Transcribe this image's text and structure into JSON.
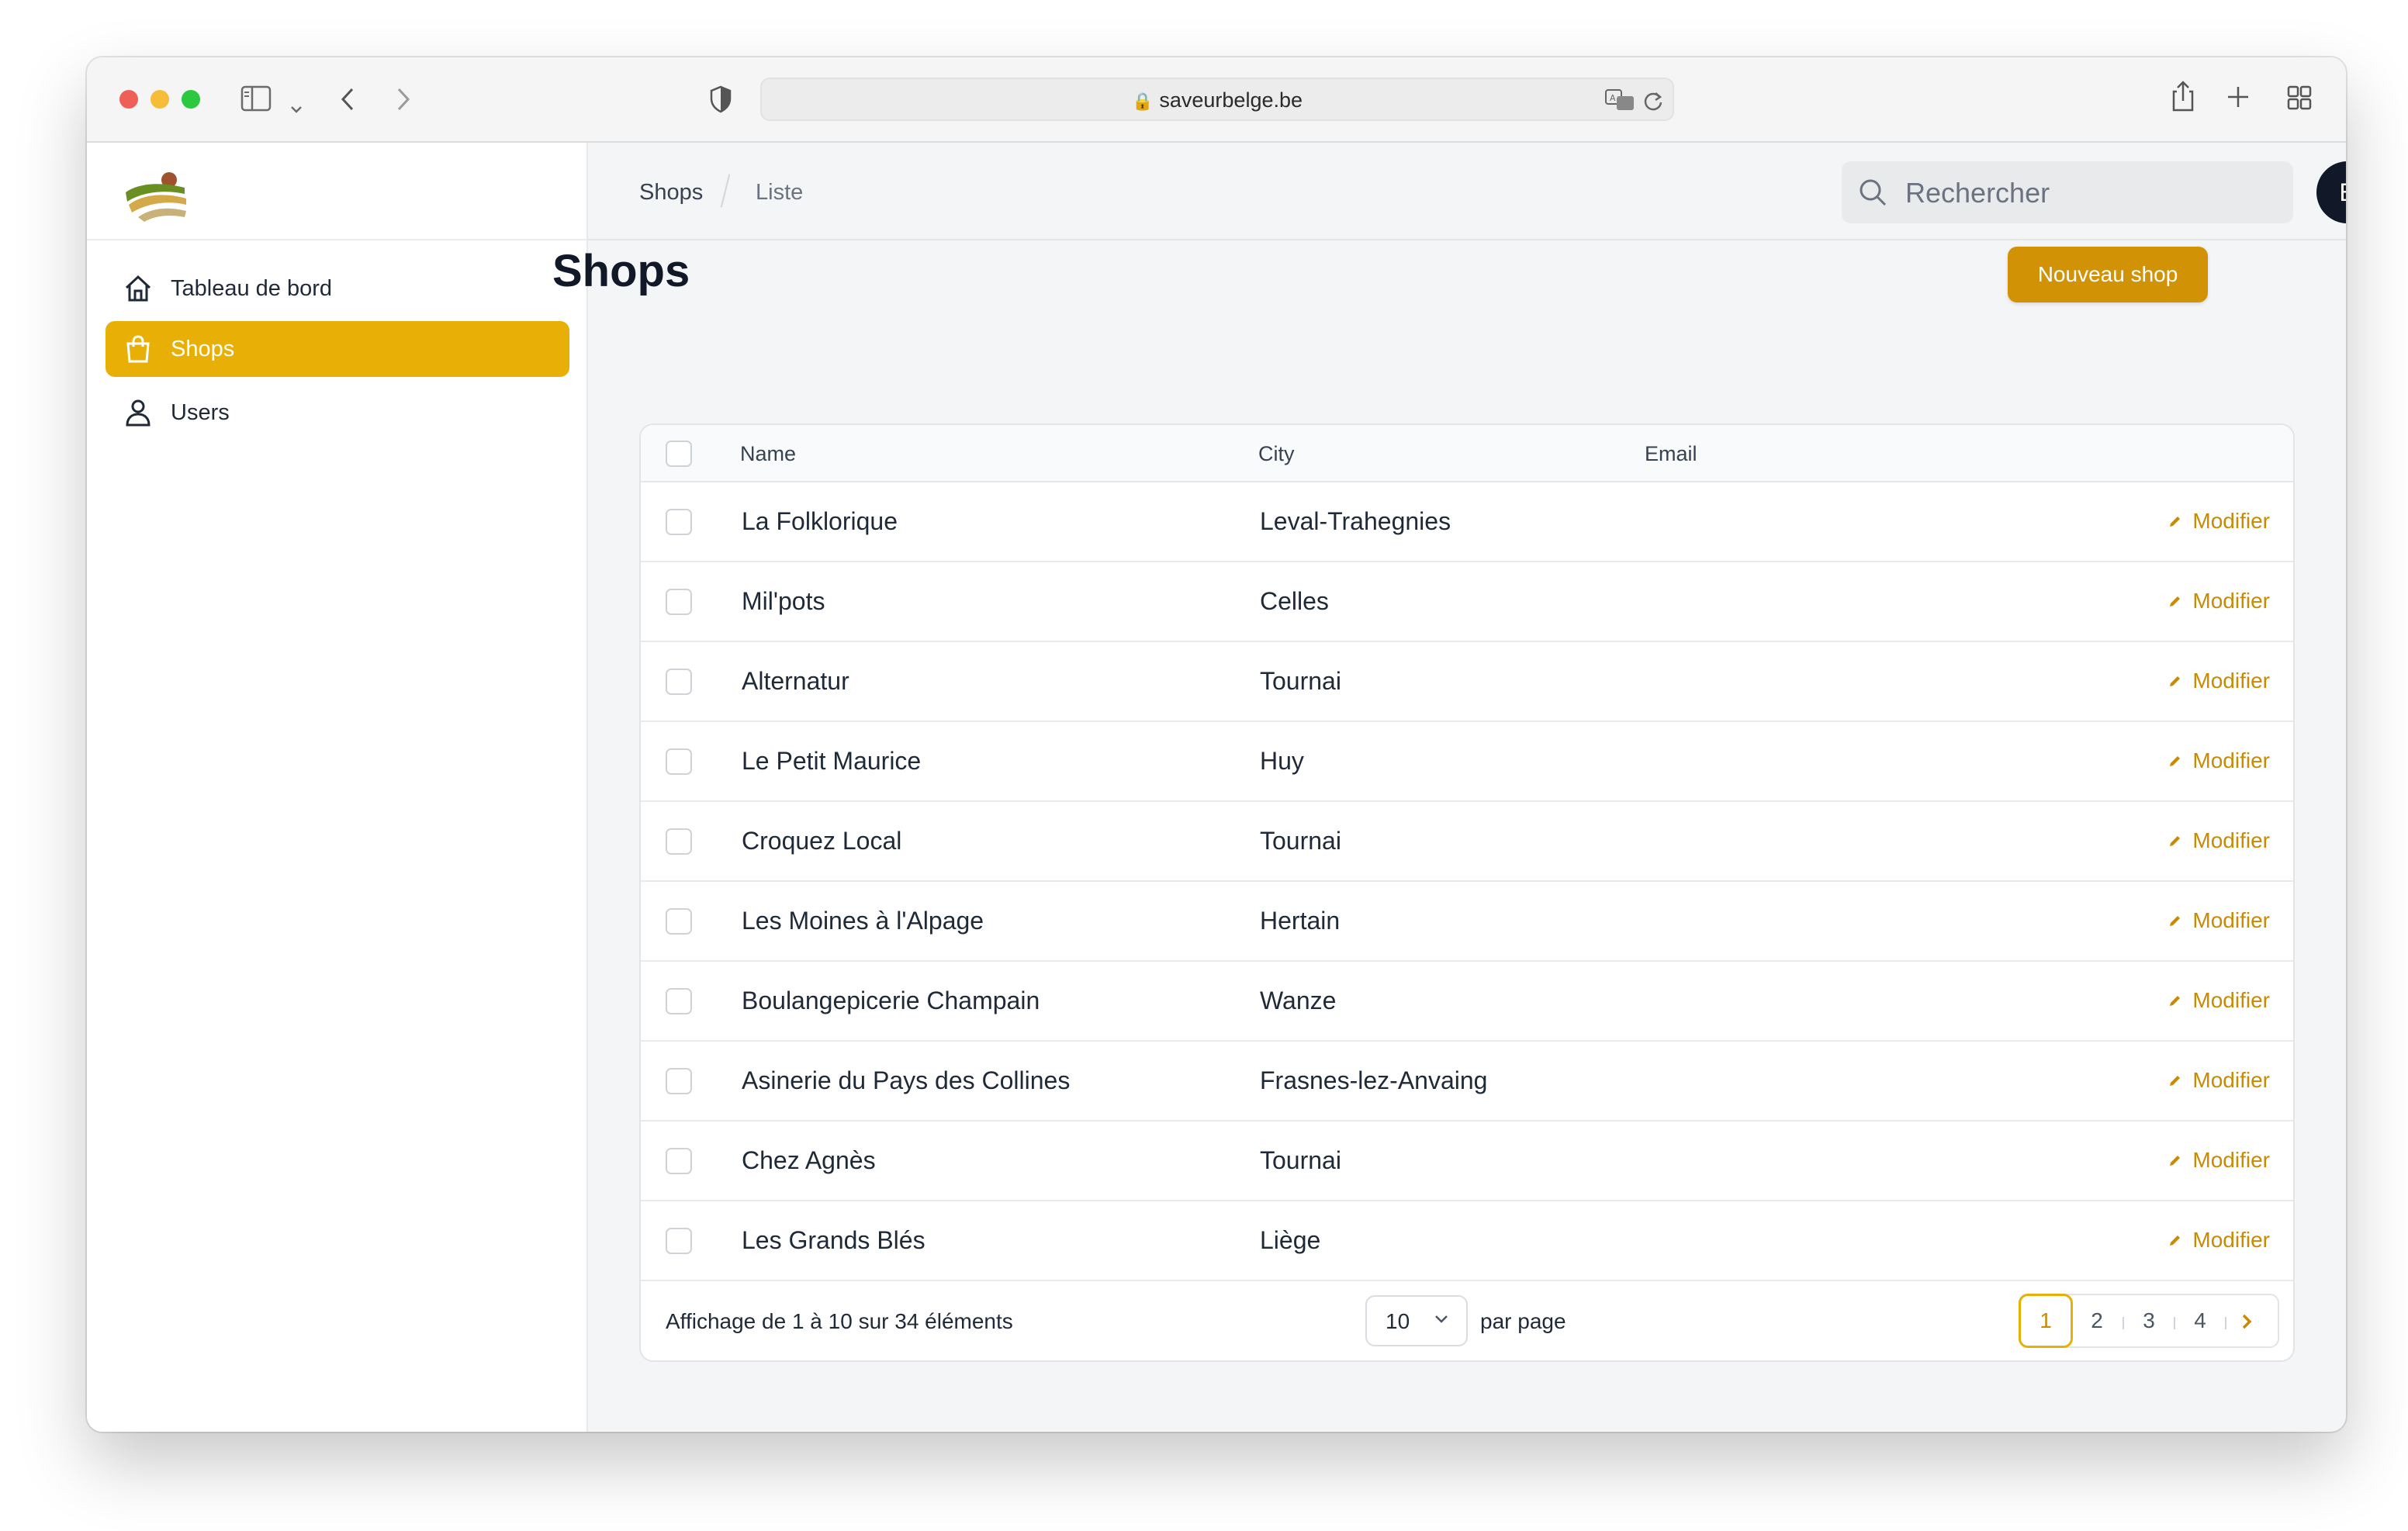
{
  "browser": {
    "url": "saveurbelge.be"
  },
  "sidebar": {
    "items": [
      {
        "label": "Tableau de bord",
        "icon": "home-icon",
        "active": false
      },
      {
        "label": "Shops",
        "icon": "shopping-bag-icon",
        "active": true
      },
      {
        "label": "Users",
        "icon": "user-icon",
        "active": false
      }
    ]
  },
  "topbar": {
    "breadcrumb": [
      "Shops",
      "Liste"
    ],
    "search_placeholder": "Rechercher",
    "avatar_initial": "B"
  },
  "page": {
    "title": "Shops",
    "new_button": "Nouveau shop"
  },
  "table": {
    "headers": [
      "Name",
      "City",
      "Email"
    ],
    "edit_label": "Modifier",
    "rows": [
      {
        "name": "La Folklorique",
        "city": "Leval-Trahegnies",
        "email": ""
      },
      {
        "name": "Mil'pots",
        "city": "Celles",
        "email": ""
      },
      {
        "name": "Alternatur",
        "city": "Tournai",
        "email": ""
      },
      {
        "name": "Le Petit Maurice",
        "city": "Huy",
        "email": ""
      },
      {
        "name": "Croquez Local",
        "city": "Tournai",
        "email": ""
      },
      {
        "name": "Les Moines à l'Alpage",
        "city": "Hertain",
        "email": ""
      },
      {
        "name": "Boulangepicerie Champain",
        "city": "Wanze",
        "email": ""
      },
      {
        "name": "Asinerie du Pays des Collines",
        "city": "Frasnes-lez-Anvaing",
        "email": ""
      },
      {
        "name": "Chez Agnès",
        "city": "Tournai",
        "email": ""
      },
      {
        "name": "Les Grands Blés",
        "city": "Liège",
        "email": ""
      }
    ]
  },
  "pagination": {
    "summary": "Affichage de 1 à 10 sur 34 éléments",
    "per_page_value": "10",
    "per_page_label": "par page",
    "pages": [
      "1",
      "2",
      "3",
      "4"
    ],
    "current_page": "1"
  },
  "colors": {
    "accent": "#e8b007",
    "button": "#d19305",
    "link": "#c98a04"
  }
}
